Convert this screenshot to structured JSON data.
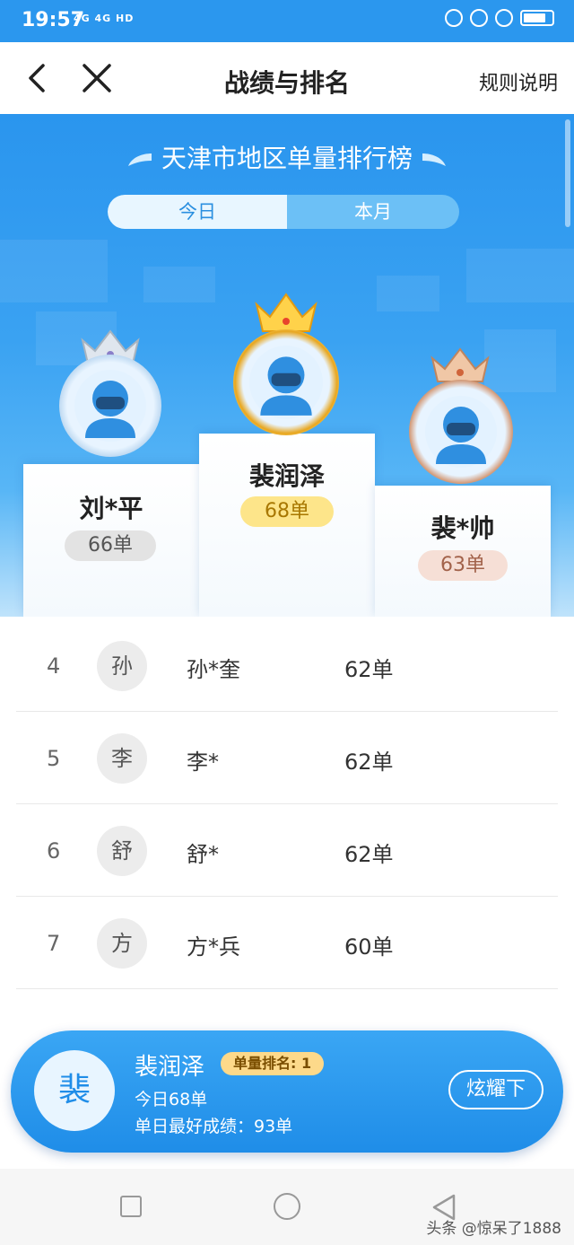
{
  "status": {
    "time": "19:57",
    "network": "4G 4G HD"
  },
  "header": {
    "title": "战绩与排名",
    "rules_label": "规则说明"
  },
  "banner": {
    "heading": "天津市地区单量排行榜",
    "tabs": [
      {
        "label": "今日",
        "active": true
      },
      {
        "label": "本月",
        "active": false
      }
    ]
  },
  "podium": [
    {
      "rank": 2,
      "name": "刘*平",
      "count": "66单",
      "medal": "silver"
    },
    {
      "rank": 1,
      "name": "裴润泽",
      "count": "68单",
      "medal": "gold"
    },
    {
      "rank": 3,
      "name": "裴*帅",
      "count": "63单",
      "medal": "bronze"
    }
  ],
  "list": [
    {
      "rank": "4",
      "initial": "孙",
      "name": "孙*奎",
      "count": "62单"
    },
    {
      "rank": "5",
      "initial": "李",
      "name": "李*",
      "count": "62单"
    },
    {
      "rank": "6",
      "initial": "舒",
      "name": "舒*",
      "count": "62单"
    },
    {
      "rank": "7",
      "initial": "方",
      "name": "方*兵",
      "count": "60单"
    }
  ],
  "my_card": {
    "initial": "裴",
    "name": "裴润泽",
    "badge": "单量排名: 1",
    "today": "今日68单",
    "best": "单日最好成绩：93单",
    "button": "炫耀下"
  },
  "watermark": "头条 @惊呆了1888",
  "colors": {
    "primary": "#2b97ee",
    "gold": "#fde58a",
    "silver": "#e3e3e3",
    "bronze": "#f6dfd6"
  }
}
